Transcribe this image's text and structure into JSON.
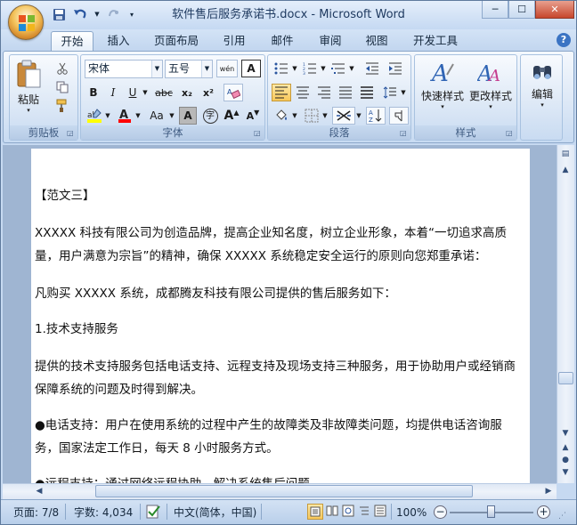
{
  "window": {
    "title": "软件售后服务承诺书.docx - Microsoft Word",
    "minimize": "─",
    "maximize": "☐",
    "close": "✕"
  },
  "ribbon_tabs": [
    {
      "label": "开始",
      "active": true
    },
    {
      "label": "插入"
    },
    {
      "label": "页面布局"
    },
    {
      "label": "引用"
    },
    {
      "label": "邮件"
    },
    {
      "label": "审阅"
    },
    {
      "label": "视图"
    },
    {
      "label": "开发工具"
    }
  ],
  "help": "?",
  "groups": {
    "clipboard": {
      "label": "剪贴板",
      "paste": "粘贴"
    },
    "font": {
      "label": "字体",
      "font_name": "宋体",
      "font_size": "五号",
      "bold": "B",
      "italic": "I",
      "underline": "U",
      "strikethrough": "abc",
      "subscript": "x₂",
      "superscript": "x²",
      "change_case": "Aa",
      "char_shading": "A",
      "enclose": "字",
      "grow": "A",
      "shrink": "A",
      "phonetic": "wén",
      "border_char": "A"
    },
    "paragraph": {
      "label": "段落"
    },
    "styles": {
      "label": "样式",
      "quick_styles": "快速样式",
      "change_styles": "更改样式"
    },
    "editing": {
      "label": "编辑"
    }
  },
  "document": {
    "paragraphs": [
      "【范文三】",
      "XXXXX 科技有限公司为创造品牌，提高企业知名度，树立企业形象，本着“一切追求高质量，用户满意为宗旨”的精神，确保 XXXXX 系统稳定安全运行的原则向您郑重承诺：",
      "凡购买 XXXXX 系统，成都腾友科技有限公司提供的售后服务如下：",
      "1.技术支持服务",
      "提供的技术支持服务包括电话支持、远程支持及现场支持三种服务，用于协助用户或经销商保障系统的问题及时得到解决。",
      "●电话支持：用户在使用系统的过程中产生的故障类及非故障类问题，均提供电话咨询服务，国家法定工作日，每天 8 小时服务方式。",
      "●远程支持：通过网络远程协助，解决系统售后问题"
    ]
  },
  "status_bar": {
    "page": "页面: 7/8",
    "words": "字数: 4,034",
    "language": "中文(简体，中国)",
    "zoom": "100%"
  },
  "colors": {
    "highlight": "#ffff00",
    "font_color": "#ff0000"
  }
}
